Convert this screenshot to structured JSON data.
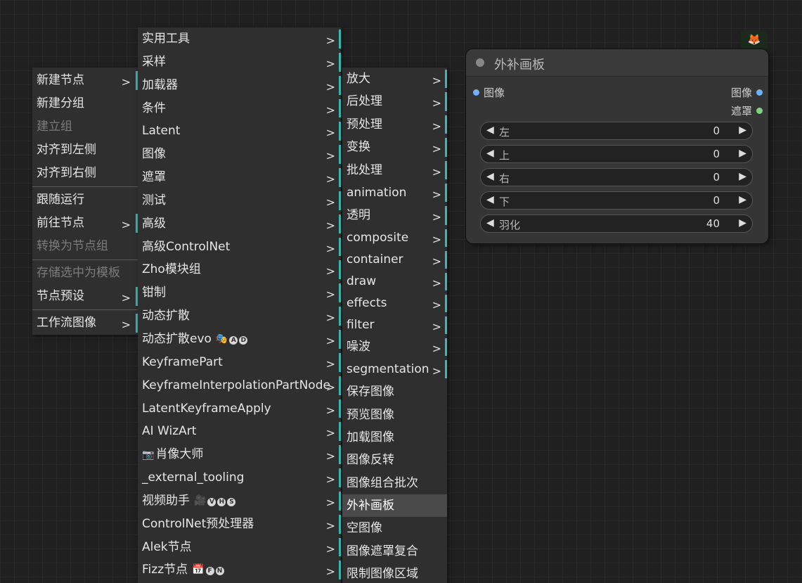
{
  "main_menu": {
    "items": [
      {
        "label": "新建节点",
        "arrow": ">",
        "submenu": true,
        "disabled": false
      },
      {
        "label": "新建分组",
        "arrow": "",
        "submenu": false,
        "disabled": false
      },
      {
        "label": "建立组",
        "arrow": "",
        "submenu": false,
        "disabled": true
      },
      {
        "label": "对齐到左侧",
        "arrow": "",
        "submenu": false,
        "disabled": false
      },
      {
        "label": "对齐到右侧",
        "arrow": "",
        "submenu": false,
        "disabled": false
      },
      {
        "separator": true
      },
      {
        "label": "跟随运行",
        "arrow": "",
        "submenu": false,
        "disabled": false
      },
      {
        "label": "前往节点",
        "arrow": ">",
        "submenu": true,
        "disabled": false
      },
      {
        "label": "转换为节点组",
        "arrow": "",
        "submenu": false,
        "disabled": true
      },
      {
        "separator": true
      },
      {
        "label": "存储选中为模板",
        "arrow": "",
        "submenu": false,
        "disabled": true
      },
      {
        "label": "节点预设",
        "arrow": ">",
        "submenu": true,
        "disabled": false
      },
      {
        "separator": true
      },
      {
        "label": "工作流图像",
        "arrow": ">",
        "submenu": true,
        "disabled": false
      }
    ]
  },
  "category_menu": {
    "items": [
      {
        "label": "实用工具"
      },
      {
        "label": "采样"
      },
      {
        "label": "加载器"
      },
      {
        "label": "条件"
      },
      {
        "label": "Latent"
      },
      {
        "label": "图像"
      },
      {
        "label": "遮罩"
      },
      {
        "label": "测试"
      },
      {
        "label": "高级"
      },
      {
        "label": "高级ControlNet"
      },
      {
        "label": "Zho模块组"
      },
      {
        "label": "钳制"
      },
      {
        "label": "动态扩散"
      },
      {
        "label": "动态扩散evo",
        "emoji": "🎭",
        "badges": [
          "A",
          "D"
        ]
      },
      {
        "label": "KeyframePart"
      },
      {
        "label": "KeyframeInterpolationPartNode"
      },
      {
        "label": "LatentKeyframeApply"
      },
      {
        "label": "AI WizArt"
      },
      {
        "label": "肖像大师",
        "prefix_emoji": "📷"
      },
      {
        "label": "_external_tooling"
      },
      {
        "label": "视频助手",
        "emoji": "🎥",
        "badges": [
          "V",
          "H",
          "S"
        ]
      },
      {
        "label": "ControlNet预处理器"
      },
      {
        "label": "Alek节点"
      },
      {
        "label": "Fizz节点",
        "emoji": "📅",
        "badges": [
          "F",
          "N"
        ]
      }
    ],
    "arrow": ">"
  },
  "image_menu": {
    "items": [
      {
        "label": "放大",
        "submenu": true
      },
      {
        "label": "后处理",
        "submenu": true
      },
      {
        "label": "预处理",
        "submenu": true
      },
      {
        "label": "变换",
        "submenu": true
      },
      {
        "label": "批处理",
        "submenu": true
      },
      {
        "label": "animation",
        "submenu": true
      },
      {
        "label": "透明",
        "submenu": true
      },
      {
        "label": "composite",
        "submenu": true
      },
      {
        "label": "container",
        "submenu": true
      },
      {
        "label": "draw",
        "submenu": true
      },
      {
        "label": "effects",
        "submenu": true
      },
      {
        "label": "filter",
        "submenu": true
      },
      {
        "label": "噪波",
        "submenu": true
      },
      {
        "label": "segmentation",
        "submenu": true
      },
      {
        "label": "保存图像",
        "submenu": false
      },
      {
        "label": "预览图像",
        "submenu": false
      },
      {
        "label": "加载图像",
        "submenu": false
      },
      {
        "label": "图像反转",
        "submenu": false
      },
      {
        "label": "图像组合批次",
        "submenu": false
      },
      {
        "label": "外补画板",
        "submenu": false,
        "highlighted": true
      },
      {
        "label": "空图像",
        "submenu": false
      },
      {
        "label": "图像遮罩复合",
        "submenu": false
      },
      {
        "label": "限制图像区域",
        "submenu": false
      }
    ],
    "arrow": ">"
  },
  "node": {
    "title": "外补画板",
    "input_image": "图像",
    "output_image": "图像",
    "output_mask": "遮罩",
    "widgets": [
      {
        "label": "左",
        "value": "0"
      },
      {
        "label": "上",
        "value": "0"
      },
      {
        "label": "右",
        "value": "0"
      },
      {
        "label": "下",
        "value": "0"
      },
      {
        "label": "羽化",
        "value": "40"
      }
    ],
    "widget_left_arrow": "◀",
    "widget_right_arrow": "▶",
    "colors": {
      "image_slot": "#6fb1ff",
      "mask_slot": "#7fd27f"
    }
  },
  "corner_badge": {
    "icon": "fox-icon",
    "glyph": "🦊"
  }
}
